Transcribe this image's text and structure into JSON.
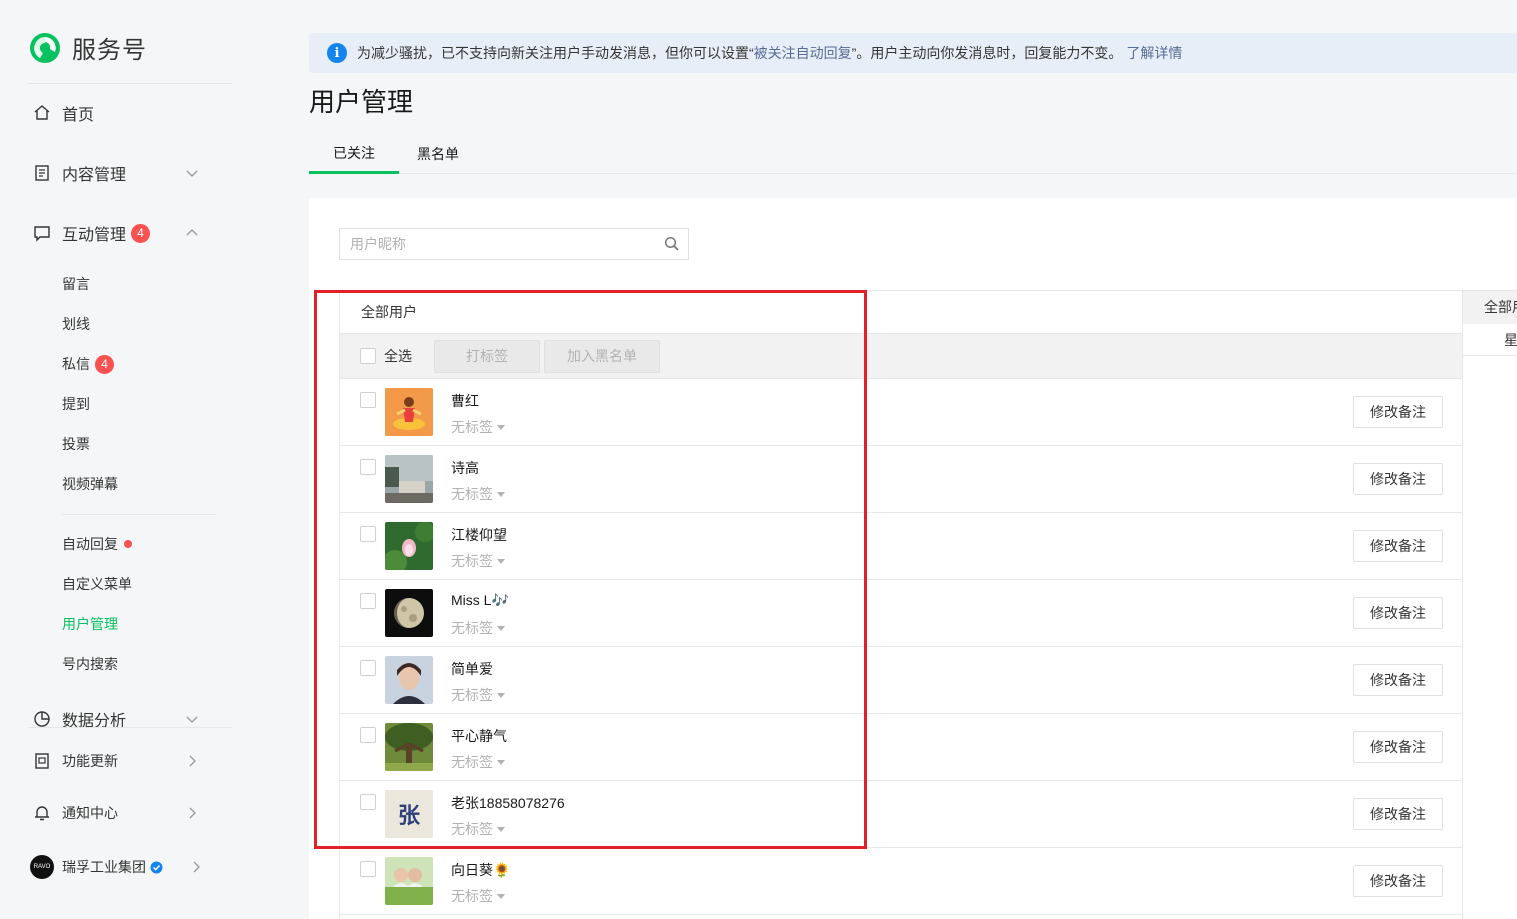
{
  "app": {
    "name": "服务号"
  },
  "sidebar": {
    "home": "首页",
    "content": "内容管理",
    "interaction": {
      "label": "互动管理",
      "badge": "4"
    },
    "sub_items": [
      {
        "label": "留言"
      },
      {
        "label": "划线"
      },
      {
        "label": "私信",
        "badge": "4"
      },
      {
        "label": "提到"
      },
      {
        "label": "投票"
      },
      {
        "label": "视频弹幕"
      },
      {
        "label": "自动回复"
      },
      {
        "label": "自定义菜单"
      },
      {
        "label": "用户管理"
      },
      {
        "label": "号内搜索"
      }
    ],
    "analytics": "数据分析",
    "updates": "功能更新",
    "notifications": "通知中心",
    "account": {
      "name": "瑞孚工业集团",
      "avatar_text": "RAVO"
    }
  },
  "notice": {
    "before": "为减少骚扰，已不支持向新关注用户手动发消息，但你可以设置“",
    "highlight": "被关注自动回复",
    "after": "”。用户主动向你发消息时，回复能力不变。",
    "link": "了解详情"
  },
  "page_title": "用户管理",
  "tabs": [
    {
      "label": "已关注"
    },
    {
      "label": "黑名单"
    }
  ],
  "search": {
    "placeholder": "用户昵称"
  },
  "list": {
    "header": "全部用户",
    "select_all": "全选",
    "tag_btn": "打标签",
    "blacklist_btn": "加入黑名单",
    "edit_label": "修改备注",
    "users": [
      {
        "name": "曹红",
        "tag": "无标签"
      },
      {
        "name": "诗高",
        "tag": "无标签"
      },
      {
        "name": "江楼仰望",
        "tag": "无标签"
      },
      {
        "name": "Miss L🎶",
        "tag": "无标签"
      },
      {
        "name": "简单爱",
        "tag": "无标签"
      },
      {
        "name": "平心静气",
        "tag": "无标签"
      },
      {
        "name": "老张18858078276",
        "tag": "无标签",
        "avatar_text": "张"
      },
      {
        "name": "向日葵🌻",
        "tag": "无标签"
      }
    ]
  },
  "right_panel": {
    "header": "全部用户",
    "item": "星标用户"
  },
  "colors": {
    "accent": "#07c160",
    "badge": "#fa5151",
    "link": "#576b95",
    "highlight_box": "#e0202a"
  }
}
